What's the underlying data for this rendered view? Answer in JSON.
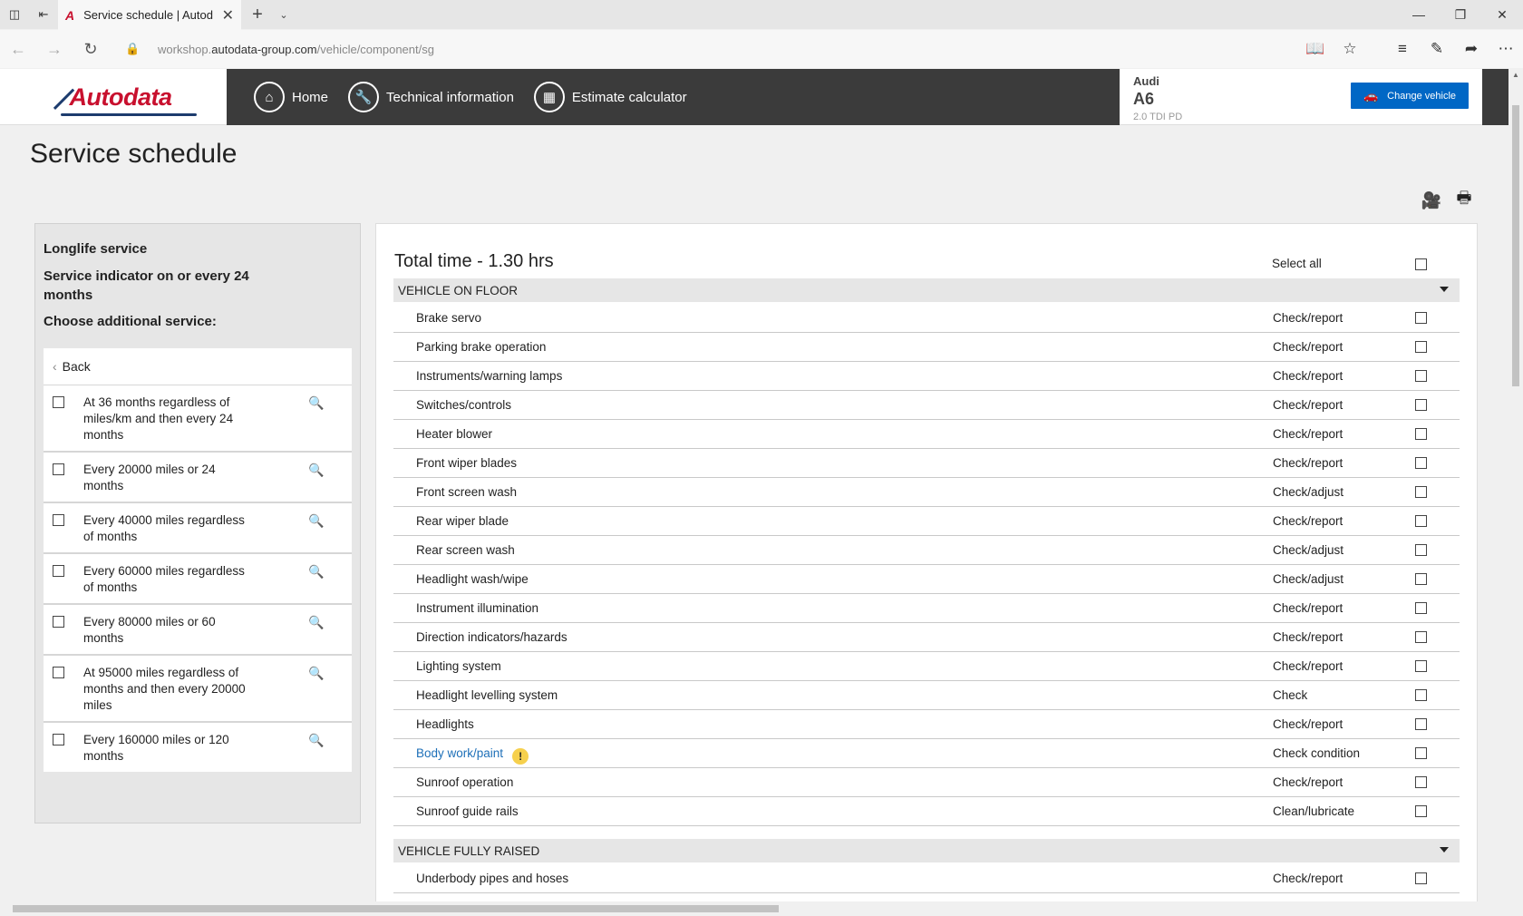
{
  "browser": {
    "tab_title": "Service schedule | Autod",
    "favicon": "A",
    "url_prefix": "workshop.",
    "url_domain": "autodata-group.com",
    "url_path": "/vehicle/component/sg"
  },
  "header": {
    "logo_text": "Autodata",
    "nav": [
      {
        "label": "Home",
        "icon": "home-icon"
      },
      {
        "label": "Technical information",
        "icon": "wrench-icon"
      },
      {
        "label": "Estimate calculator",
        "icon": "calculator-icon"
      }
    ],
    "vehicle": {
      "make": "Audi",
      "model": "A6",
      "engine": "2.0 TDI PD"
    },
    "change_vehicle_label": "Change vehicle"
  },
  "page": {
    "title": "Service schedule"
  },
  "left_panel": {
    "heading1": "Longlife service",
    "heading2": "Service indicator on or every 24 months",
    "heading3": "Choose additional service:",
    "back_label": "Back",
    "items": [
      {
        "label": "At 36 months regardless of miles/km and then every 24 months"
      },
      {
        "label": "Every 20000 miles or 24 months"
      },
      {
        "label": "Every 40000 miles regardless of months"
      },
      {
        "label": "Every 60000 miles regardless of months"
      },
      {
        "label": "Every 80000 miles or 60 months"
      },
      {
        "label": "At 95000 miles regardless of months and then every 20000 miles"
      },
      {
        "label": "Every 160000 miles or 120 months"
      }
    ]
  },
  "schedule": {
    "total_time": "Total time - 1.30 hrs",
    "select_all_label": "Select all",
    "sections": [
      {
        "title": "VEHICLE ON FLOOR",
        "rows": [
          {
            "name": "Brake servo",
            "action": "Check/report"
          },
          {
            "name": "Parking brake operation",
            "action": "Check/report"
          },
          {
            "name": "Instruments/warning lamps",
            "action": "Check/report"
          },
          {
            "name": "Switches/controls",
            "action": "Check/report"
          },
          {
            "name": "Heater blower",
            "action": "Check/report"
          },
          {
            "name": "Front wiper blades",
            "action": "Check/report"
          },
          {
            "name": "Front screen wash",
            "action": "Check/adjust"
          },
          {
            "name": "Rear wiper blade",
            "action": "Check/report"
          },
          {
            "name": "Rear screen wash",
            "action": "Check/adjust"
          },
          {
            "name": "Headlight wash/wipe",
            "action": "Check/adjust"
          },
          {
            "name": "Instrument illumination",
            "action": "Check/report"
          },
          {
            "name": "Direction indicators/hazards",
            "action": "Check/report"
          },
          {
            "name": "Lighting system",
            "action": "Check/report"
          },
          {
            "name": "Headlight levelling system",
            "action": "Check"
          },
          {
            "name": "Headlights",
            "action": "Check/report"
          },
          {
            "name": "Body work/paint",
            "action": "Check condition"
          },
          {
            "name": "Sunroof operation",
            "action": "Check/report"
          },
          {
            "name": "Sunroof guide rails",
            "action": "Clean/lubricate"
          }
        ]
      },
      {
        "title": "VEHICLE FULLY RAISED",
        "rows": [
          {
            "name": "Underbody pipes and hoses",
            "action": "Check/report"
          }
        ]
      }
    ]
  },
  "colors": {
    "brand_red": "#c8102e",
    "nav_dark": "#3b3b3b",
    "button_blue": "#0067c5",
    "link_blue": "#1d6fb8",
    "warning_yellow": "#f6d04d"
  }
}
